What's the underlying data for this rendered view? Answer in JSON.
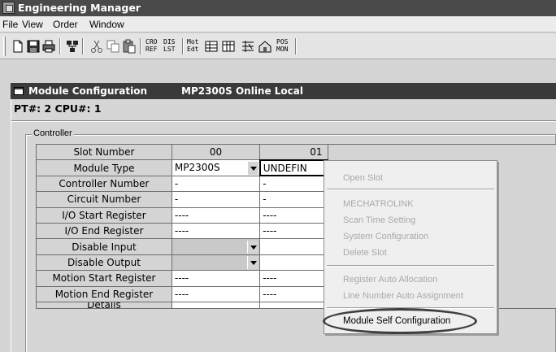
{
  "app": {
    "title": "Engineering Manager",
    "icon": "app-icon"
  },
  "menubar": {
    "items": [
      "File",
      "View",
      "Order",
      "Window"
    ]
  },
  "toolbar": {
    "buttons": [
      {
        "name": "new-icon"
      },
      {
        "name": "save-icon"
      },
      {
        "name": "print-icon"
      },
      {
        "name": "network-icon"
      },
      {
        "name": "cut-icon"
      },
      {
        "name": "copy-icon"
      },
      {
        "name": "paste-icon"
      }
    ],
    "text_buttons": [
      {
        "name": "cro-ref-button",
        "label": "CRO\nREF"
      },
      {
        "name": "dis-lst-button",
        "label": "DIS\nLST"
      },
      {
        "name": "mot-edt-button",
        "label": "Mot\nEdt"
      },
      {
        "name": "pos-mon-button",
        "label": "POS\nMON"
      }
    ]
  },
  "window": {
    "title": "Module Configuration",
    "status": "MP2300S  Online  Local",
    "location": "PT#: 2 CPU#: 1"
  },
  "controller": {
    "legend": "Controller",
    "columns": [
      "00",
      "01"
    ],
    "rows": [
      {
        "label": "Slot Number",
        "c0": "00",
        "c1": "01"
      },
      {
        "label": "Module Type",
        "c0": "MP2300S",
        "c1": "UNDEFIN"
      },
      {
        "label": "Controller Number",
        "c0": "-",
        "c1": "-"
      },
      {
        "label": "Circuit Number",
        "c0": "-",
        "c1": "-"
      },
      {
        "label": "I/O Start Register",
        "c0": "----",
        "c1": "----"
      },
      {
        "label": "I/O End Register",
        "c0": "----",
        "c1": "----"
      },
      {
        "label": "Disable Input",
        "c0": "",
        "c1": ""
      },
      {
        "label": "Disable Output",
        "c0": "",
        "c1": ""
      },
      {
        "label": "Motion Start Register",
        "c0": "----",
        "c1": "----"
      },
      {
        "label": "Motion End Register",
        "c0": "----",
        "c1": "----"
      },
      {
        "label": "Details",
        "c0": "",
        "c1": ""
      }
    ]
  },
  "context_menu": {
    "items": [
      {
        "label": "Open Slot",
        "enabled": false
      },
      {
        "label": "MECHATROLINK",
        "enabled": false
      },
      {
        "label": "Scan Time Setting",
        "enabled": false
      },
      {
        "label": "System Configuration",
        "enabled": false
      },
      {
        "label": "Delete Slot",
        "enabled": false
      },
      {
        "label": "Register Auto Allocation",
        "enabled": false
      },
      {
        "label": "Line Number Auto Assignment",
        "enabled": false
      },
      {
        "label": "Module Self Configuration",
        "enabled": true
      }
    ]
  }
}
